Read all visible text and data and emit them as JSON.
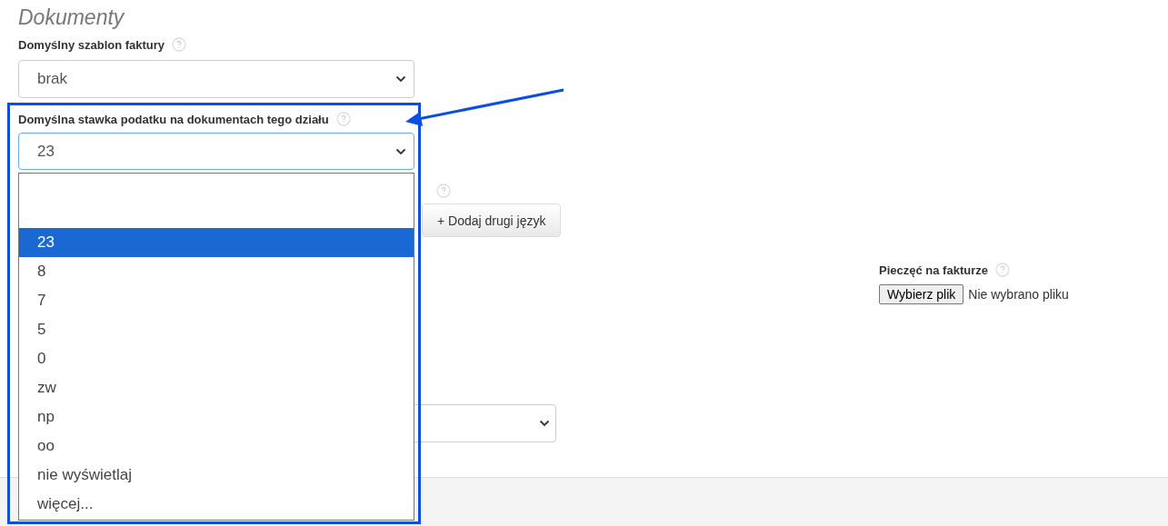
{
  "section_title": "Dokumenty",
  "invoice_template": {
    "label": "Domyślny szablon faktury",
    "value": "brak"
  },
  "tax_rate": {
    "label": "Domyślna stawka podatku na dokumentach tego działu",
    "value": "23",
    "expanded": true,
    "options": [
      {
        "label": "23",
        "selected": true
      },
      {
        "label": "8",
        "selected": false
      },
      {
        "label": "7",
        "selected": false
      },
      {
        "label": "5",
        "selected": false
      },
      {
        "label": "0",
        "selected": false
      },
      {
        "label": "zw",
        "selected": false
      },
      {
        "label": "np",
        "selected": false
      },
      {
        "label": "oo",
        "selected": false
      },
      {
        "label": "nie wyświetlaj",
        "selected": false
      },
      {
        "label": "więcej...",
        "selected": false
      }
    ]
  },
  "add_language_button": "+ Dodaj drugi język",
  "stamp": {
    "label": "Pieczęć na fakturze",
    "button": "Wybierz plik",
    "status": "Nie wybrano pliku"
  }
}
